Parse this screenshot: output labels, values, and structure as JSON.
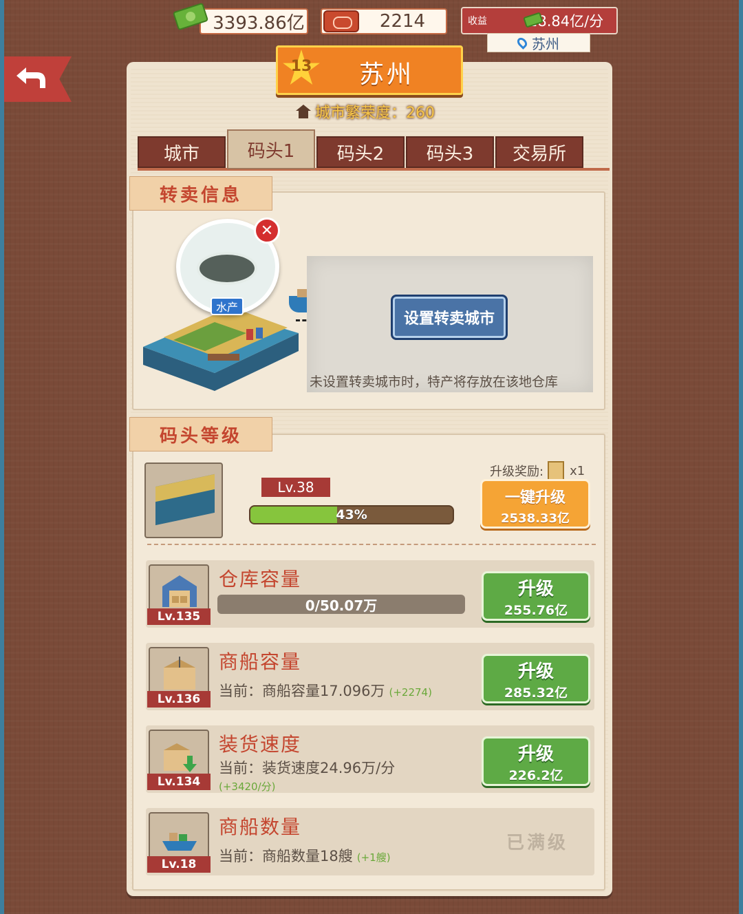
{
  "top_bar": {
    "money": "3393.86亿",
    "tickets": "2214",
    "income_label": "收益",
    "income_value": "28.84亿/分",
    "location": "苏州"
  },
  "city": {
    "level": "13",
    "name": "苏州",
    "prosperity": "城市繁荣度：260"
  },
  "tabs": [
    "城市",
    "码头1",
    "码头2",
    "码头3",
    "交易所"
  ],
  "active_tab": "码头1",
  "resale": {
    "header": "转卖信息",
    "product_tag": "水产",
    "set_city_button": "设置转卖城市",
    "note": "未设置转卖城市时，特产将存放在该地仓库"
  },
  "dock_level": {
    "header": "码头等级",
    "level": "Lv.38",
    "progress_label": "43%",
    "progress_fraction": 0.43,
    "reward_label": "升级奖励:",
    "reward_count": "x1",
    "one_key_label": "一键升级",
    "one_key_cost": "2538.33亿"
  },
  "upgrades": [
    {
      "title": "仓库容量",
      "level": "Lv.135",
      "bar_text": "0/50.07万",
      "button": "升级",
      "cost": "255.76亿"
    },
    {
      "title": "商船容量",
      "level": "Lv.136",
      "current": "当前：商船容量17.096万",
      "delta": "(+2274)",
      "button": "升级",
      "cost": "285.32亿"
    },
    {
      "title": "装货速度",
      "level": "Lv.134",
      "current": "当前：装货速度24.96万/分",
      "delta": "(+3420/分)",
      "button": "升级",
      "cost": "226.2亿"
    },
    {
      "title": "商船数量",
      "level": "Lv.18",
      "current": "当前：商船数量18艘",
      "delta": "(+1艘)",
      "status": "已满级"
    }
  ],
  "colors": {
    "background": "#7a4a38",
    "paper": "#efe3cf",
    "accent_red": "#c4462f",
    "upgrade_green": "#5eaa45",
    "one_key_orange": "#f5a435"
  }
}
